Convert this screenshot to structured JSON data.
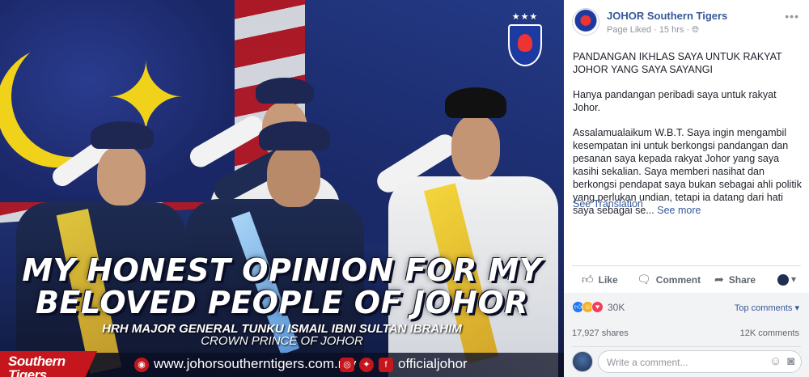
{
  "image": {
    "headline_1": "MY HONEST OPINION FOR MY",
    "headline_2": "BELOVED PEOPLE OF JOHOR",
    "subline_1": "HRH MAJOR GENERAL TUNKU ISMAIL IBNI SULTAN IBRAHIM",
    "subline_2": "CROWN PRINCE OF JOHOR",
    "logo_text": "Southern Tigers",
    "website": "www.johorsoutherntigers.com.my",
    "social_handle": "officialjohor",
    "crest_stars": "★★★"
  },
  "post": {
    "page_name": "JOHOR Southern Tigers",
    "meta": "Page Liked · 15 hrs · ",
    "title": "PANDANGAN IKHLAS SAYA UNTUK RAKYAT JOHOR YANG SAYA SAYANGI",
    "intro": "Hanya pandangan peribadi saya untuk rakyat Johor.",
    "body": "Assalamualaikum W.B.T. Saya ingin mengambil kesempatan ini untuk berkongsi pandangan dan pesanan saya kepada rakyat Johor yang saya kasihi sekalian. Saya memberi nasihat dan berkongsi pendapat saya bukan sebagai ahli politik yang perlukan undian, tetapi ia datang dari hati saya sebagai se... ",
    "see_more": "See more",
    "see_translation": "See Translation"
  },
  "actions": {
    "like": "Like",
    "comment": "Comment",
    "share": "Share"
  },
  "stats": {
    "reaction_count": "30K",
    "top_comments": "Top comments ▾",
    "shares": "17,927 shares",
    "comments": "12K comments"
  },
  "comment_input": {
    "placeholder": "Write a comment..."
  },
  "colors": {
    "link": "#365899",
    "brand_red": "#c4161c"
  }
}
